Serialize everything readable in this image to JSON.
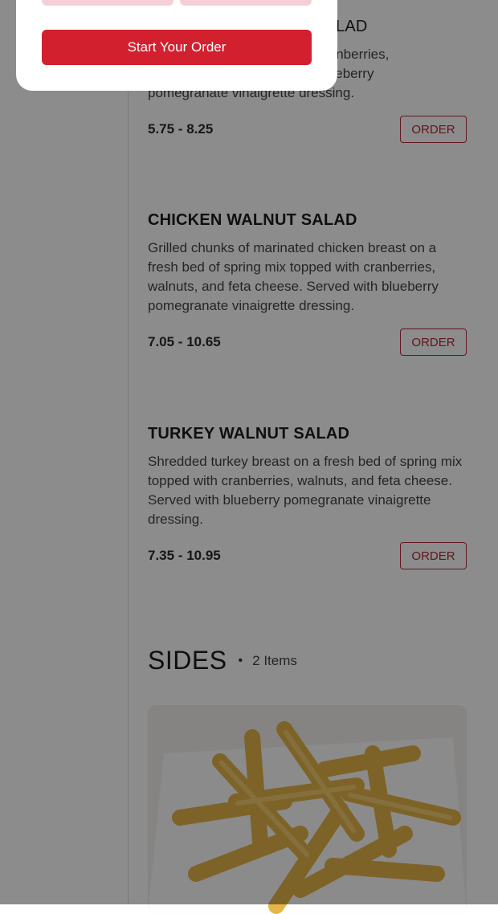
{
  "modal": {
    "start_order_label": "Start Your Order"
  },
  "menu": {
    "items": [
      {
        "name": "LAD",
        "description": "ed with cranberries, ed with blueberry pomegranate vinaigrette dressing.",
        "description_lines": [
          "ed with cranberries,",
          "ed with blueberry",
          "pomegranate vinaigrette dressing."
        ],
        "price": "5.75 - 8.25",
        "order_label": "ORDER"
      },
      {
        "name": "CHICKEN WALNUT SALAD",
        "description": "Grilled chunks of marinated chicken breast on a fresh bed of spring mix topped with cranberries, walnuts, and feta cheese. Served with blueberry pomegranate vinaigrette dressing.",
        "price": "7.05 - 10.65",
        "order_label": "ORDER"
      },
      {
        "name": "TURKEY WALNUT SALAD",
        "description": "Shredded turkey breast on a fresh bed of spring mix topped with cranberries, walnuts, and feta cheese. Served with blueberry pomegranate vinaigrette dressing.",
        "price": "7.35 - 10.95",
        "order_label": "ORDER"
      }
    ]
  },
  "sides_section": {
    "title": "SIDES",
    "separator": "•",
    "count": "2 Items"
  },
  "colors": {
    "brand_red": "#d2202f",
    "order_outline": "#b3283a",
    "overlay": "rgba(0,0,0,0.45)"
  },
  "icons": {
    "food_image": "crinkle-cut-fries-image"
  }
}
